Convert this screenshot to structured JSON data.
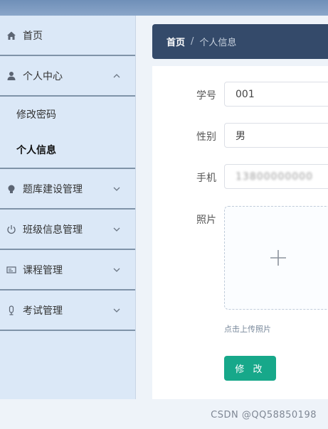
{
  "sidebar": {
    "items": [
      {
        "label": "首页",
        "icon": "home-icon"
      },
      {
        "label": "个人中心",
        "icon": "user-icon",
        "expanded": true,
        "children": [
          {
            "label": "修改密码"
          },
          {
            "label": "个人信息",
            "active": true
          }
        ]
      },
      {
        "label": "题库建设管理",
        "icon": "bulb-icon"
      },
      {
        "label": "班级信息管理",
        "icon": "power-icon"
      },
      {
        "label": "课程管理",
        "icon": "card-icon"
      },
      {
        "label": "考试管理",
        "icon": "mic-icon"
      }
    ]
  },
  "breadcrumb": {
    "home": "首页",
    "separator": "/",
    "current": "个人信息"
  },
  "form": {
    "student_id_label": "学号",
    "student_id_value": "001",
    "gender_label": "性别",
    "gender_value": "男",
    "phone_label": "手机",
    "phone_value": "13800000000",
    "photo_label": "照片",
    "upload_tip": "点击上传照片",
    "submit_label": "修 改"
  },
  "watermark": "CSDN @QQ58850198",
  "colors": {
    "sidebar_bg": "#dbe8f7",
    "header_bg": "#344a6a",
    "button_bg": "#17a88a"
  }
}
